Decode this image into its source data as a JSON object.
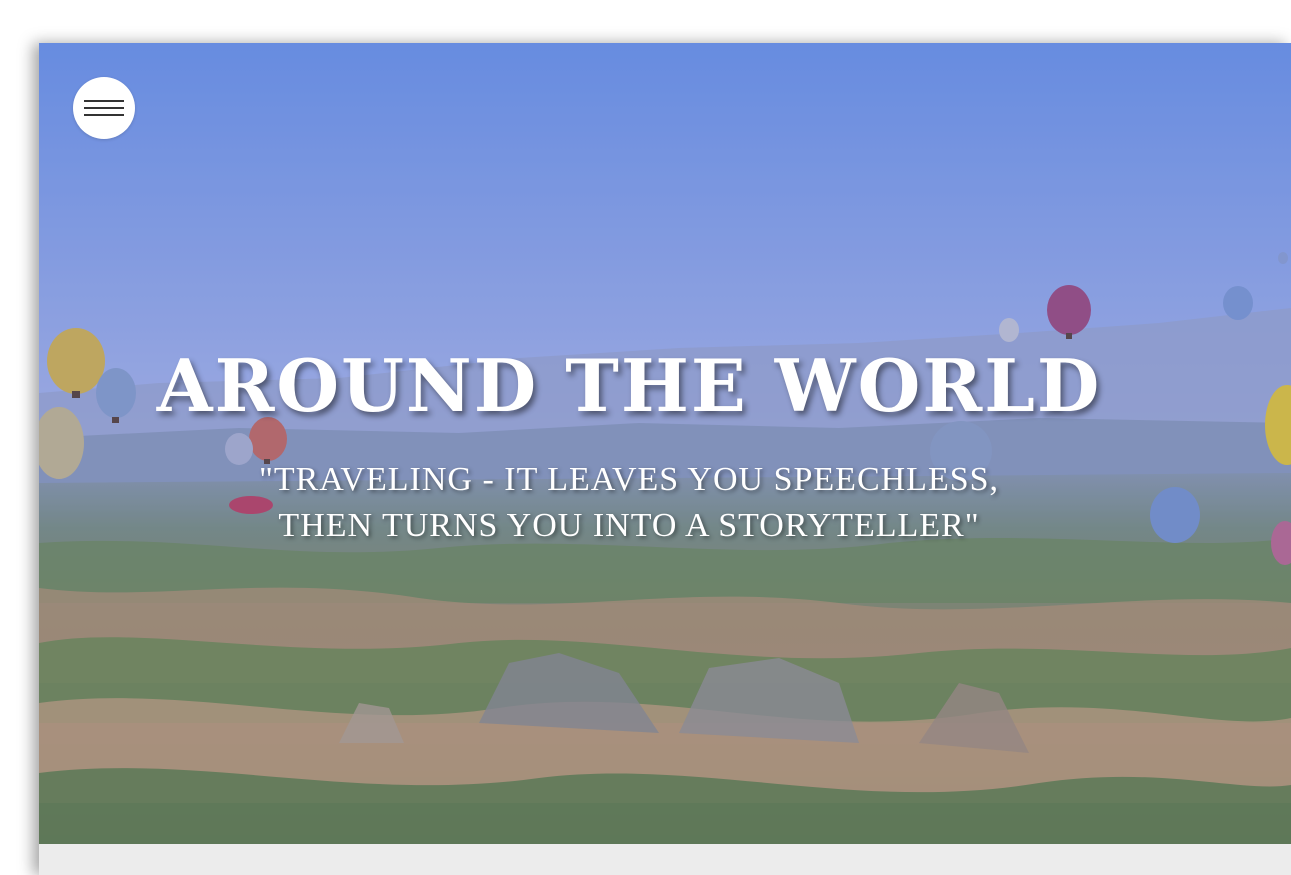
{
  "hero": {
    "title": "AROUND THE WORLD",
    "quote_line1": "\"TRAVELING - IT LEAVES YOU SPEECHLESS,",
    "quote_line2": "THEN TURNS YOU INTO A STORYTELLER\"",
    "background_image": "hot-air-balloons-over-valley"
  },
  "menu": {
    "icon": "hamburger-menu-icon"
  },
  "colors": {
    "sky_top": "#6f95e3",
    "sky_bottom": "#c7cce6",
    "land_green": "#6f8f4a",
    "land_tan": "#c29a6a",
    "title_text": "#ffffff",
    "menu_button": "#ffffff"
  }
}
